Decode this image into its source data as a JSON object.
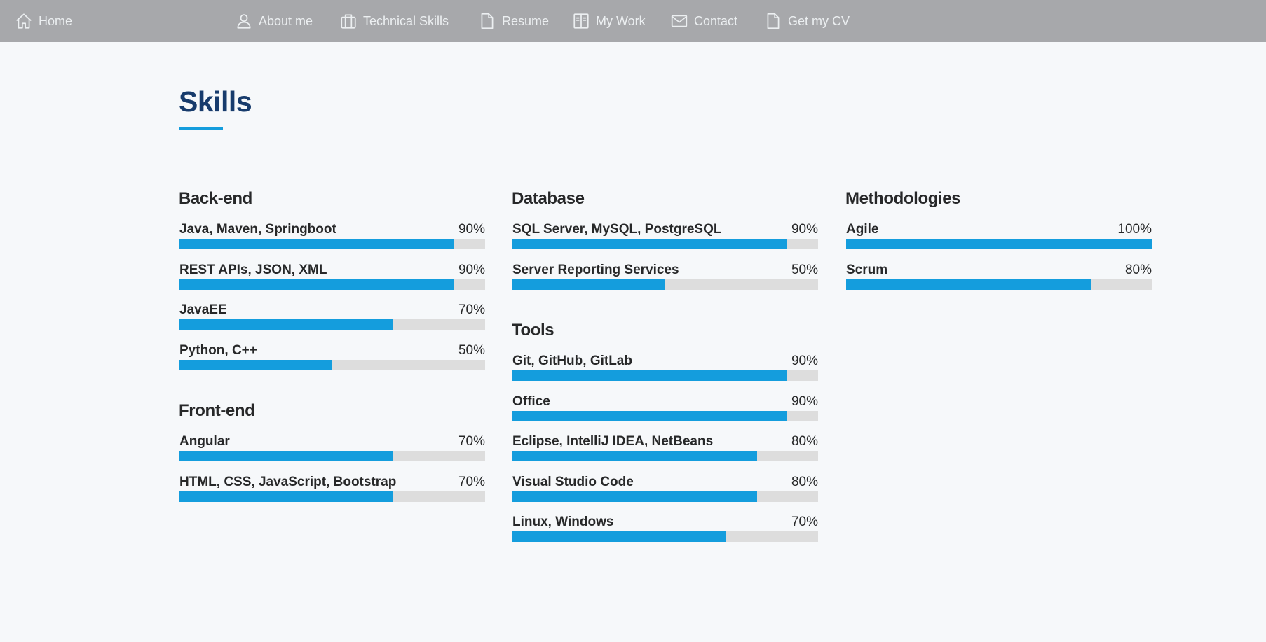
{
  "nav": {
    "items": [
      {
        "label": "Home",
        "icon": "home-icon"
      },
      {
        "label": "About me",
        "icon": "person-icon"
      },
      {
        "label": "Technical Skills",
        "icon": "briefcase-icon"
      },
      {
        "label": "Resume",
        "icon": "file-icon"
      },
      {
        "label": "My Work",
        "icon": "book-icon"
      },
      {
        "label": "Contact",
        "icon": "envelope-icon"
      },
      {
        "label": "Get my CV",
        "icon": "file-icon"
      }
    ]
  },
  "section": {
    "title": "Skills"
  },
  "colors": {
    "accent": "#149ddd",
    "title": "#173b6c",
    "nav_bg": "#a7a8ab",
    "track": "#dddddd"
  },
  "skills": {
    "backend": {
      "title": "Back-end",
      "items": [
        {
          "name": "Java, Maven, Springboot",
          "label": "90%",
          "level": 90
        },
        {
          "name": "REST APIs, JSON, XML",
          "label": "90%",
          "level": 90
        },
        {
          "name": "JavaEE",
          "label": "70%",
          "level": 70
        },
        {
          "name": "Python, C++",
          "label": "50%",
          "level": 50
        }
      ]
    },
    "frontend": {
      "title": "Front-end",
      "items": [
        {
          "name": "Angular",
          "label": "70%",
          "level": 70
        },
        {
          "name": "HTML, CSS, JavaScript, Bootstrap",
          "label": "70%",
          "level": 70
        }
      ]
    },
    "database": {
      "title": "Database",
      "items": [
        {
          "name": "SQL Server, MySQL, PostgreSQL",
          "label": "90%",
          "level": 90
        },
        {
          "name": "Server Reporting Services",
          "label": "50%",
          "level": 50
        }
      ]
    },
    "tools": {
      "title": "Tools",
      "items": [
        {
          "name": "Git, GitHub, GitLab",
          "label": "90%",
          "level": 90
        },
        {
          "name": "Office",
          "label": "90%",
          "level": 90
        },
        {
          "name": "Eclipse, IntelliJ IDEA, NetBeans",
          "label": "80%",
          "level": 80
        },
        {
          "name": "Visual Studio Code",
          "label": "80%",
          "level": 80
        },
        {
          "name": "Linux, Windows",
          "label": "70%",
          "level": 70
        }
      ]
    },
    "methodologies": {
      "title": "Methodologies",
      "items": [
        {
          "name": "Agile",
          "label": "100%",
          "level": 100
        },
        {
          "name": "Scrum",
          "label": "80%",
          "level": 80
        }
      ]
    }
  }
}
